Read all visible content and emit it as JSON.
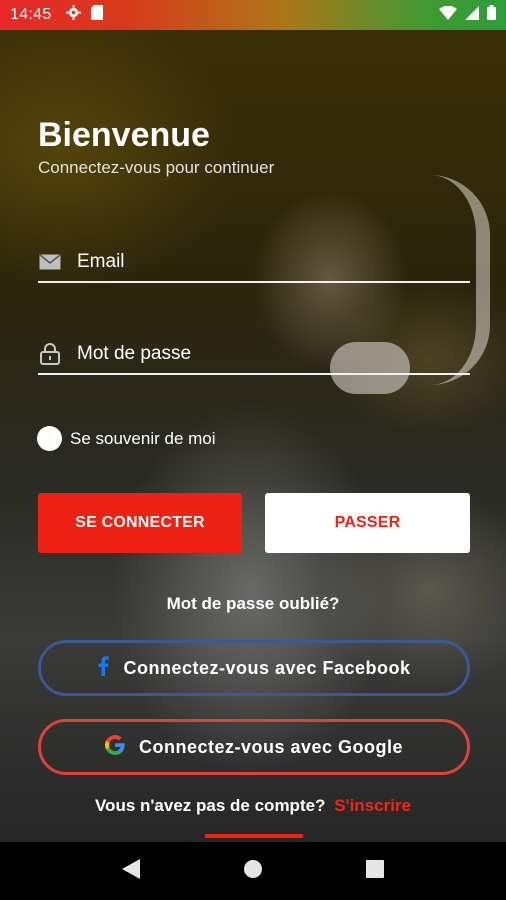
{
  "status_bar": {
    "time": "14:45",
    "icons": [
      "gear-icon",
      "sd-card-icon",
      "wifi-icon",
      "signal-icon",
      "battery-icon"
    ]
  },
  "login": {
    "title": "Bienvenue",
    "subtitle": "Connectez-vous pour continuer",
    "email_placeholder": "Email",
    "password_placeholder": "Mot de passe",
    "remember_label": "Se souvenir de moi",
    "login_button": "SE CONNECTER",
    "skip_button": "PASSER",
    "forgot_password": "Mot de passe oublié?",
    "facebook_button": "Connectez-vous avec Facebook",
    "google_button": "Connectez-vous avec Google",
    "no_account_text": "Vous n'avez pas de compte?",
    "signup_link": "S'inscrire"
  },
  "colors": {
    "accent": "#ee2112",
    "facebook": "#3b5998",
    "google_border": "#e2403a"
  },
  "nav_bar": {
    "buttons": [
      "back-icon",
      "home-icon",
      "recents-icon"
    ]
  }
}
